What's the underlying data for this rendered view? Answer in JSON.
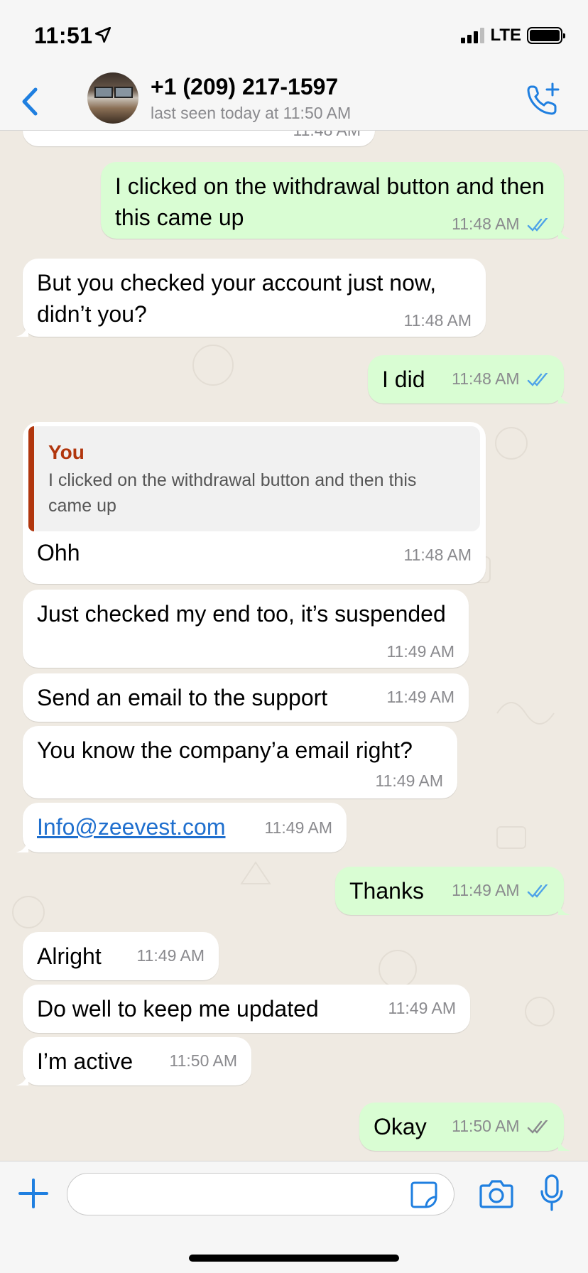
{
  "status_bar": {
    "time": "11:51",
    "network": "LTE",
    "location_icon": "location-arrow-icon"
  },
  "header": {
    "contact_name": "+1 (209) 217-1597",
    "last_seen": "last seen today at 11:50 AM",
    "back_icon": "chevron-left-icon",
    "call_icon": "add-call-icon",
    "accent_color": "#1f7fe0"
  },
  "messages": [
    {
      "direction": "in",
      "text": "",
      "time": "11:48 AM",
      "partial": true
    },
    {
      "direction": "out",
      "text": "I clicked on the withdrawal button and then this came up",
      "time": "11:48 AM",
      "read": true
    },
    {
      "direction": "in",
      "text": "But you checked your account just now, didn’t you?",
      "time": "11:48 AM"
    },
    {
      "direction": "out",
      "text": "I did",
      "time": "11:48 AM",
      "read": true
    },
    {
      "direction": "in",
      "text": "Ohh",
      "time": "11:48 AM",
      "quote": {
        "author": "You",
        "text": "I clicked on the withdrawal button and then this came up"
      }
    },
    {
      "direction": "in",
      "text": "Just checked my end too, it’s suspended",
      "time": "11:49 AM"
    },
    {
      "direction": "in",
      "text": "Send an email to the support",
      "time": "11:49 AM"
    },
    {
      "direction": "in",
      "text": "You know the company’a email right?",
      "time": "11:49 AM"
    },
    {
      "direction": "in",
      "text": "Info@zeevest.com",
      "time": "11:49 AM",
      "is_link": true
    },
    {
      "direction": "out",
      "text": "Thanks",
      "time": "11:49 AM",
      "read": true
    },
    {
      "direction": "in",
      "text": "Alright",
      "time": "11:49 AM"
    },
    {
      "direction": "in",
      "text": "Do well to keep me updated",
      "time": "11:49 AM"
    },
    {
      "direction": "in",
      "text": "I’m active",
      "time": "11:50 AM"
    },
    {
      "direction": "out",
      "text": "Okay",
      "time": "11:50 AM",
      "read": false
    }
  ],
  "composer": {
    "placeholder": "",
    "icons": [
      "plus-icon",
      "sticker-icon",
      "camera-icon",
      "microphone-icon"
    ]
  },
  "colors": {
    "incoming_bubble": "#ffffff",
    "outgoing_bubble": "#d9fdd3",
    "chat_background": "#efeae2",
    "read_tick": "#4fa3e8",
    "quote_author": "#b1360d",
    "link": "#1f6fce"
  }
}
